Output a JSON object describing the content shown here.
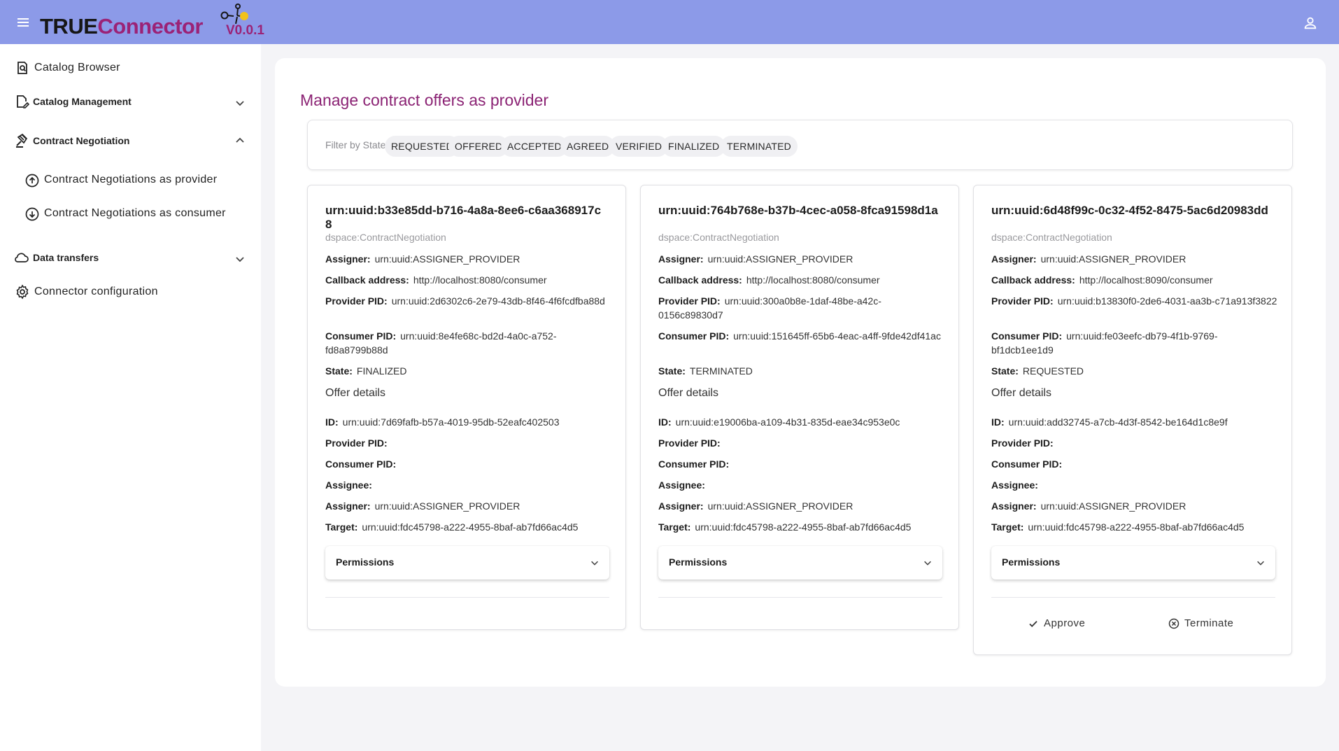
{
  "app": {
    "logo_part1": "TRUE",
    "logo_part2": "Connector",
    "version": "V0.0.1"
  },
  "sidebar": {
    "items": [
      {
        "label": "Catalog Browser",
        "icon": "catalog-search-icon"
      },
      {
        "label": "Catalog Management",
        "icon": "document-edit-icon",
        "expanded": false
      },
      {
        "label": "Contract Negotiation",
        "icon": "gavel-icon",
        "expanded": true,
        "children": [
          {
            "label": "Contract Negotiations as provider",
            "icon": "arrow-up-circle-icon"
          },
          {
            "label": "Contract Negotiations as consumer",
            "icon": "arrow-down-circle-icon"
          }
        ]
      },
      {
        "label": "Data transfers",
        "icon": "cloud-icon",
        "expanded": false
      },
      {
        "label": "Connector configuration",
        "icon": "gear-icon"
      }
    ]
  },
  "main": {
    "title": "Manage contract offers as provider",
    "filter": {
      "label": "Filter by State",
      "states": [
        "REQUESTED",
        "OFFERED",
        "ACCEPTED",
        "AGREED",
        "VERIFIED",
        "FINALIZED",
        "TERMINATED"
      ]
    },
    "labels": {
      "assigner": "Assigner:",
      "callback": "Callback address:",
      "provider_pid": "Provider PID:",
      "consumer_pid": "Consumer PID:",
      "state": "State:",
      "offer_details": "Offer details",
      "id": "ID:",
      "assignee": "Assignee:",
      "target": "Target:",
      "permissions": "Permissions",
      "approve": "Approve",
      "terminate": "Terminate"
    },
    "cards": [
      {
        "title": "urn:uuid:b33e85dd-b716-4a8a-8ee6-c6aa368917c8",
        "type": "dspace:ContractNegotiation",
        "assigner": "urn:uuid:ASSIGNER_PROVIDER",
        "callback": "http://localhost:8080/consumer",
        "provider_pid": "urn:uuid:2d6302c6-2e79-43db-8f46-4f6fcdfba88d",
        "consumer_pid": "urn:uuid:8e4fe68c-bd2d-4a0c-a752-fd8a8799b88d",
        "state": "FINALIZED",
        "offer": {
          "id": "urn:uuid:7d69fafb-b57a-4019-95db-52eafc402503",
          "provider_pid": "",
          "consumer_pid": "",
          "assignee": "",
          "assigner": "urn:uuid:ASSIGNER_PROVIDER",
          "target": "urn:uuid:fdc45798-a222-4955-8baf-ab7fd66ac4d5"
        }
      },
      {
        "title": "urn:uuid:764b768e-b37b-4cec-a058-8fca91598d1a",
        "type": "dspace:ContractNegotiation",
        "assigner": "urn:uuid:ASSIGNER_PROVIDER",
        "callback": "http://localhost:8080/consumer",
        "provider_pid": "urn:uuid:300a0b8e-1daf-48be-a42c-0156c89830d7",
        "consumer_pid": "urn:uuid:151645ff-65b6-4eac-a4ff-9fde42df41ac",
        "state": "TERMINATED",
        "offer": {
          "id": "urn:uuid:e19006ba-a109-4b31-835d-eae34c953e0c",
          "provider_pid": "",
          "consumer_pid": "",
          "assignee": "",
          "assigner": "urn:uuid:ASSIGNER_PROVIDER",
          "target": "urn:uuid:fdc45798-a222-4955-8baf-ab7fd66ac4d5"
        }
      },
      {
        "title": "urn:uuid:6d48f99c-0c32-4f52-8475-5ac6d20983dd",
        "type": "dspace:ContractNegotiation",
        "assigner": "urn:uuid:ASSIGNER_PROVIDER",
        "callback": "http://localhost:8090/consumer",
        "provider_pid": "urn:uuid:b13830f0-2de6-4031-aa3b-c71a913f3822",
        "consumer_pid": "urn:uuid:fe03eefc-db79-4f1b-9769-bf1dcb1ee1d9",
        "state": "REQUESTED",
        "offer": {
          "id": "urn:uuid:add32745-a7cb-4d3f-8542-be164d1c8e9f",
          "provider_pid": "",
          "consumer_pid": "",
          "assignee": "",
          "assigner": "urn:uuid:ASSIGNER_PROVIDER",
          "target": "urn:uuid:fdc45798-a222-4955-8baf-ab7fd66ac4d5"
        }
      }
    ]
  },
  "colors": {
    "header": "#8c9ae8",
    "brand": "#9b2276",
    "title": "#8b2374"
  }
}
